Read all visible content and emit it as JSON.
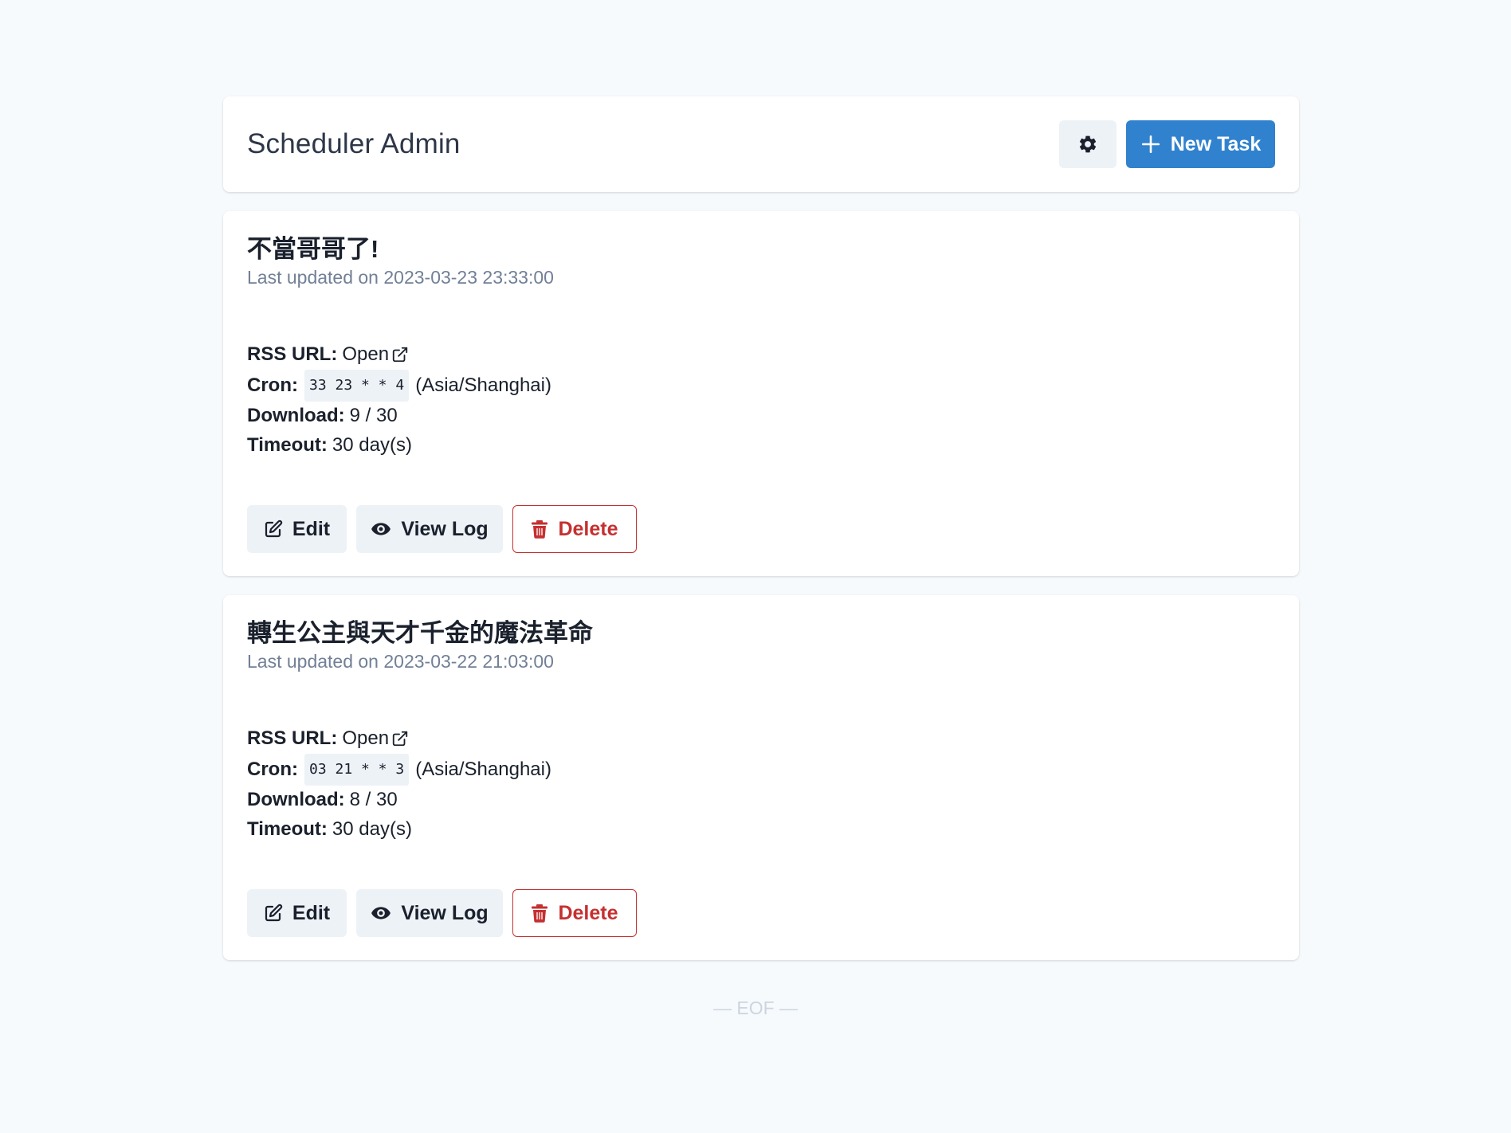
{
  "header": {
    "title": "Scheduler Admin",
    "settings_icon": "gear-icon",
    "new_task_label": "New Task",
    "new_task_icon": "plus-icon"
  },
  "labels": {
    "rss_url": "RSS URL:",
    "cron": "Cron:",
    "download": "Download:",
    "timeout": "Timeout:",
    "open_link": "Open",
    "edit": "Edit",
    "view_log": "View Log",
    "delete": "Delete"
  },
  "tasks": [
    {
      "title": "不當哥哥了!",
      "updated": "Last updated on 2023-03-23 23:33:00",
      "cron": "33 23 * * 4",
      "timezone": "(Asia/Shanghai)",
      "download": "9 / 30",
      "timeout": "30 day(s)"
    },
    {
      "title": "轉生公主與天才千金的魔法革命",
      "updated": "Last updated on 2023-03-22 21:03:00",
      "cron": "03 21 * * 3",
      "timezone": "(Asia/Shanghai)",
      "download": "8 / 30",
      "timeout": "30 day(s)"
    }
  ],
  "footer": {
    "eof": "— EOF —"
  },
  "colors": {
    "primary": "#3182ce",
    "danger": "#c53030",
    "muted": "#718096",
    "background": "#f7fafc"
  }
}
